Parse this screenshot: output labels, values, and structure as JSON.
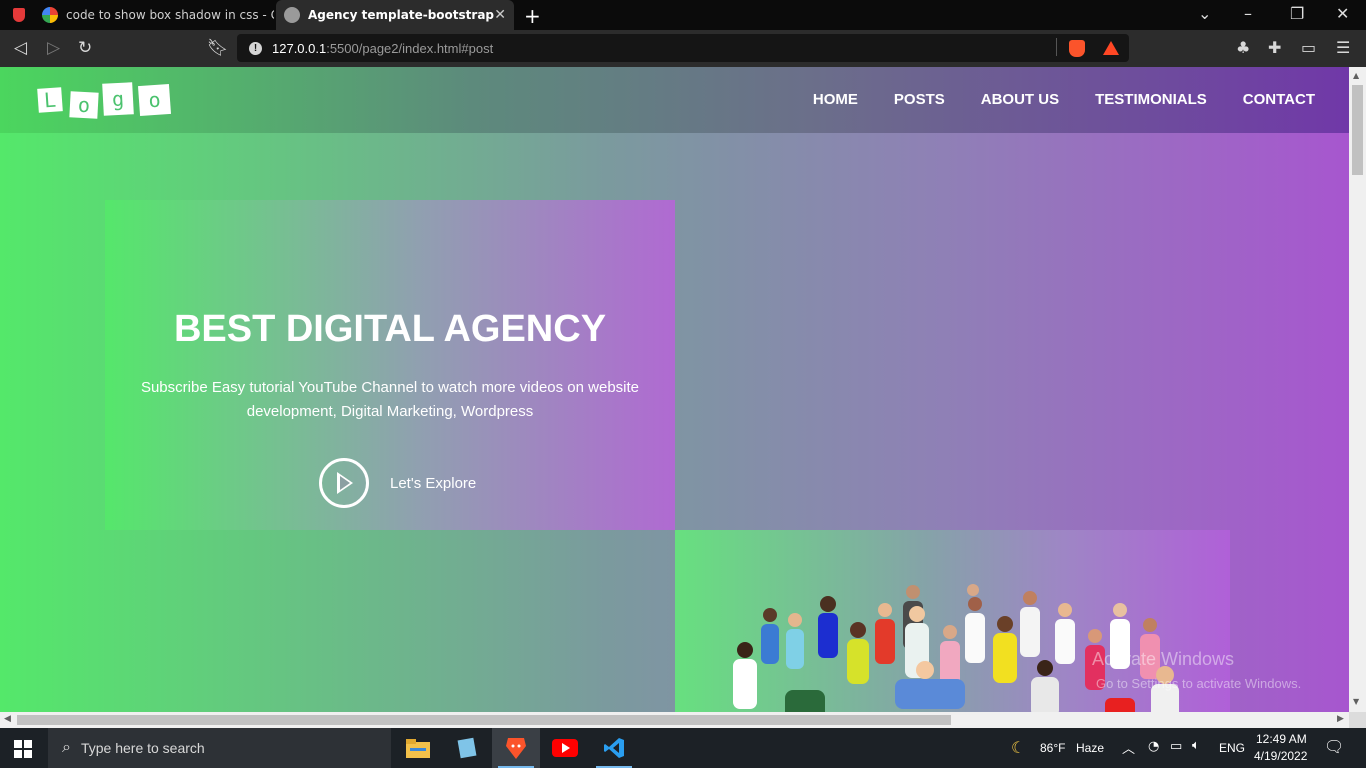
{
  "browser": {
    "tabs": [
      {
        "title": "code to show box shadow in css - Goo",
        "active": false
      },
      {
        "title": "Agency template-bootstrap tutori",
        "active": true
      }
    ],
    "address": {
      "host": "127.0.0.1",
      "path": ":5500/page2/index.html#post"
    }
  },
  "site": {
    "logo_letters": [
      "L",
      "o",
      "g",
      "o"
    ],
    "nav": [
      "HOME",
      "POSTS",
      "ABOUT US",
      "TESTIMONIALS",
      "CONTACT"
    ],
    "hero": {
      "title": "BEST DIGITAL AGENCY",
      "subtitle": "Subscribe Easy tutorial YouTube Channel to watch more videos on website development, Digital Marketing, Wordpress",
      "cta": "Let's Explore"
    },
    "watermark": {
      "line1": "Activate Windows",
      "line2": "Go to Settings to activate Windows."
    }
  },
  "taskbar": {
    "search_placeholder": "Type here to search",
    "weather": {
      "temp": "86°F",
      "condition": "Haze"
    },
    "lang": "ENG",
    "time": "12:49 AM",
    "date": "4/19/2022"
  },
  "colors": {
    "accent_green": "#54e86a",
    "accent_purple": "#a756cf",
    "taskbar": "#1c2126"
  }
}
